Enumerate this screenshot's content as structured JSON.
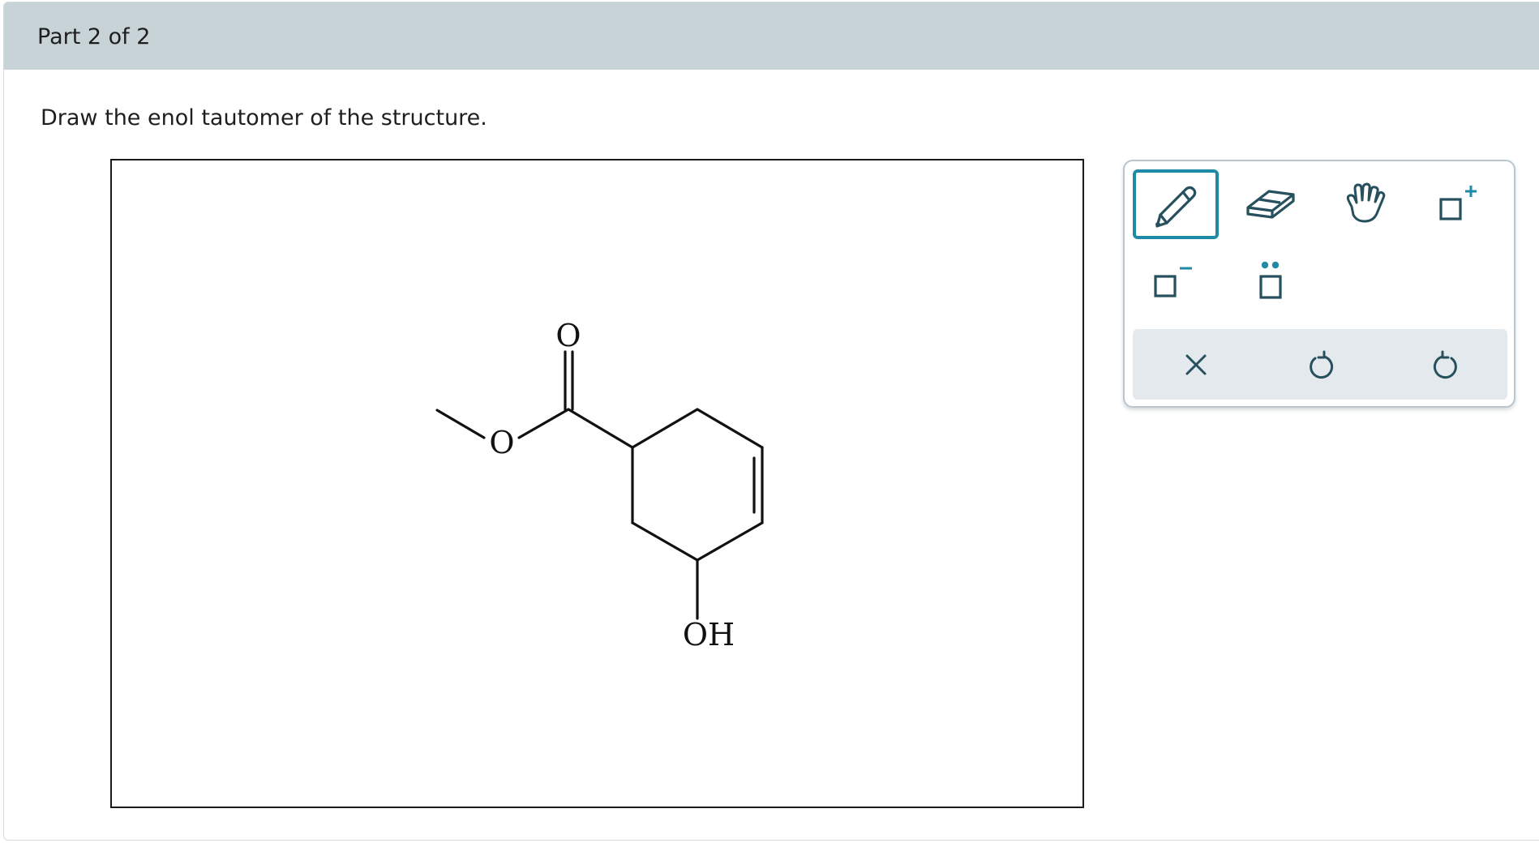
{
  "header": {
    "part_label": "Part 2 of 2"
  },
  "question": {
    "prompt": "Draw the enol tautomer of the structure."
  },
  "molecule": {
    "atoms": {
      "carbonyl_oxygen": "O",
      "ester_oxygen": "O",
      "hydroxyl": "OH"
    }
  },
  "toolbox": {
    "tools": [
      {
        "name": "pencil-icon",
        "selected": true
      },
      {
        "name": "eraser-icon",
        "selected": false
      },
      {
        "name": "hand-icon",
        "selected": false
      },
      {
        "name": "add-positive-charge-icon",
        "selected": false
      },
      {
        "name": "add-negative-charge-icon",
        "selected": false
      },
      {
        "name": "add-lone-pair-icon",
        "selected": false
      }
    ],
    "actions": [
      {
        "name": "clear-icon"
      },
      {
        "name": "undo-icon"
      },
      {
        "name": "redo-icon"
      }
    ]
  },
  "colors": {
    "accent": "#1f8aa6",
    "icon": "#27505e",
    "header_bg": "#c8d3d8",
    "action_bar_bg": "#e3e9ec"
  }
}
